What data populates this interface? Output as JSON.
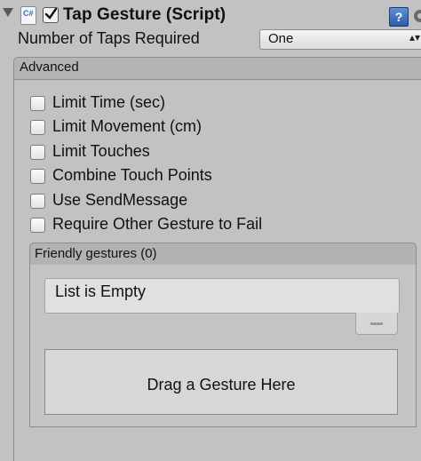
{
  "component": {
    "title": "Tap Gesture (Script)",
    "enabled": true,
    "script_icon_text": "C#",
    "help_icon_text": "?"
  },
  "taps": {
    "label": "Number of Taps Required",
    "value": "One"
  },
  "advanced": {
    "label": "Advanced",
    "options": [
      {
        "label": "Limit Time (sec)",
        "checked": false
      },
      {
        "label": "Limit Movement (cm)",
        "checked": false
      },
      {
        "label": "Limit Touches",
        "checked": false
      },
      {
        "label": "Combine Touch Points",
        "checked": false
      },
      {
        "label": "Use SendMessage",
        "checked": false
      },
      {
        "label": "Require Other Gesture to Fail",
        "checked": false
      }
    ]
  },
  "friendly_gestures": {
    "label": "Friendly gestures (0)",
    "empty_text": "List is Empty",
    "drop_label": "Drag a Gesture Here"
  }
}
